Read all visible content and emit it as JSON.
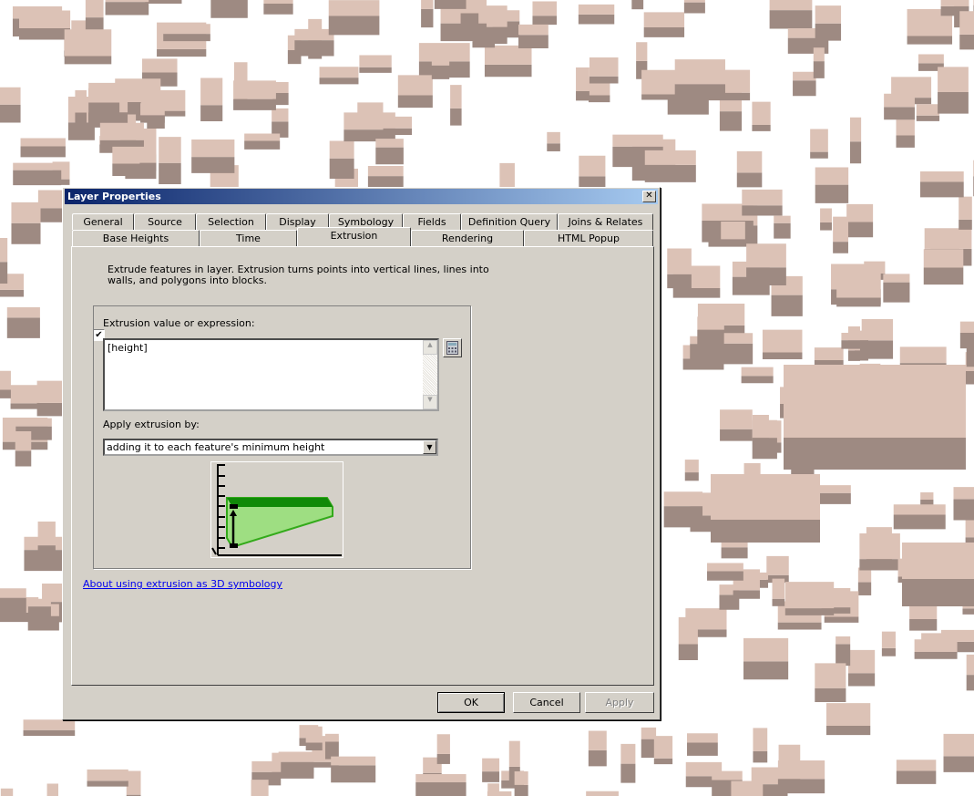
{
  "window": {
    "title": "Layer Properties",
    "close_icon": "close-icon"
  },
  "tabs_row1": [
    {
      "label": "General"
    },
    {
      "label": "Source"
    },
    {
      "label": "Selection"
    },
    {
      "label": "Display"
    },
    {
      "label": "Symbology"
    },
    {
      "label": "Fields"
    },
    {
      "label": "Definition Query"
    },
    {
      "label": "Joins & Relates"
    }
  ],
  "tabs_row2": [
    {
      "label": "Base Heights"
    },
    {
      "label": "Time"
    },
    {
      "label": "Extrusion",
      "selected": true
    },
    {
      "label": "Rendering"
    },
    {
      "label": "HTML Popup"
    }
  ],
  "extrude": {
    "checked": true,
    "label_line1": "Extrude features in layer.  Extrusion turns points into vertical lines, lines into",
    "label_line2": "walls, and polygons into blocks."
  },
  "expression": {
    "label": "Extrusion value or expression:",
    "value": "[height]",
    "calculator_icon": "calculator-icon"
  },
  "apply": {
    "label": "Apply extrusion by:",
    "selected": "adding it to each feature's minimum height"
  },
  "help_link": "About using extrusion as 3D symbology",
  "buttons": {
    "ok": "OK",
    "cancel": "Cancel",
    "apply": "Apply"
  },
  "colors": {
    "building_top": "#dcc2b6",
    "building_side": "#9e8a82",
    "accent_green": "#33aa1a"
  }
}
